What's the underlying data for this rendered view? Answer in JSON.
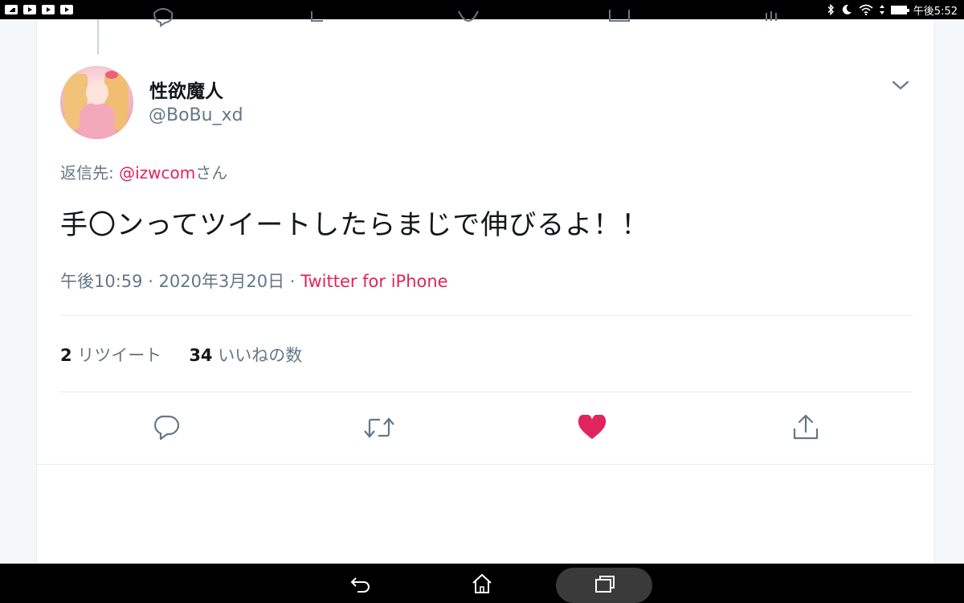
{
  "status_bar": {
    "time": "午後5:52",
    "notification_icons": [
      "gallery-icon",
      "youtube-icon",
      "youtube-icon",
      "youtube-icon"
    ],
    "system_icons": [
      "bluetooth-icon",
      "moon-icon",
      "wifi-icon",
      "battery-icon"
    ]
  },
  "tweet": {
    "author": {
      "name": "性欲魔人",
      "handle": "@BoBu_xd"
    },
    "reply_to": {
      "prefix": "返信先: ",
      "mention": "@izwcom",
      "suffix": "さん"
    },
    "text": "手〇ンってツイートしたらまじで伸びるよ！！",
    "timestamp": "午後10:59 · 2020年3月20日 · ",
    "source": "Twitter for iPhone",
    "stats": {
      "retweet_count": "2",
      "retweet_label": " リツイート",
      "like_count": "34",
      "like_label": " いいねの数"
    },
    "actions": [
      "reply-icon",
      "retweet-icon",
      "like-icon",
      "share-icon"
    ],
    "liked": true
  },
  "colors": {
    "accent": "#e0245e",
    "muted_text": "#657786",
    "icon_gray": "#657786"
  },
  "nav_bar": {
    "buttons": [
      "back-icon",
      "home-icon",
      "recent-apps-icon"
    ]
  }
}
